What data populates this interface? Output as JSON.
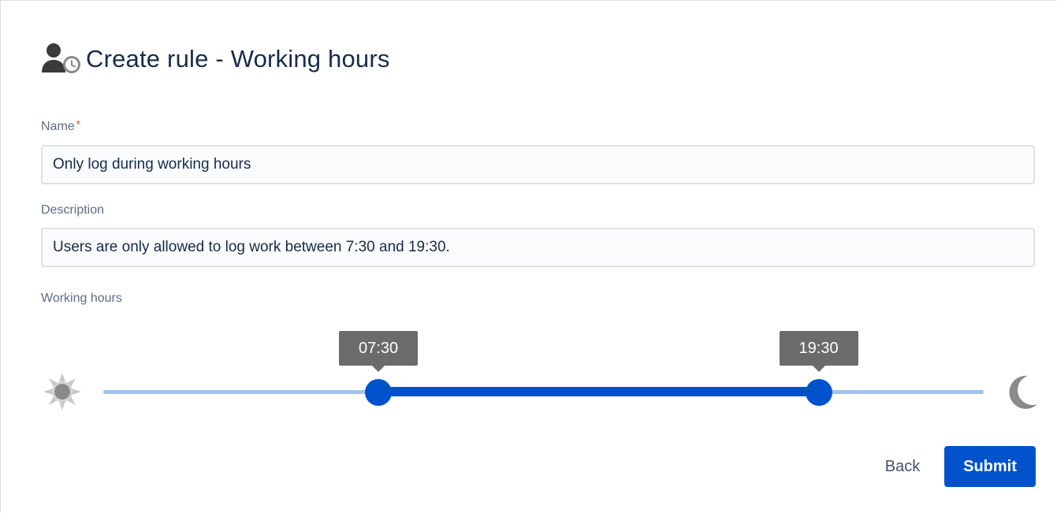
{
  "dialog": {
    "title": "Create rule - Working hours",
    "icon": "user-clock-icon"
  },
  "form": {
    "name": {
      "label": "Name",
      "required_mark": "*",
      "value": "Only log during working hours"
    },
    "description": {
      "label": "Description",
      "value": "Users are only allowed to log work between 7:30 and 19:30."
    },
    "working_hours": {
      "label": "Working hours",
      "start_label": "07:30",
      "end_label": "19:30",
      "start_fraction": 0.3125,
      "end_fraction": 0.8125,
      "left_icon": "sun-icon",
      "right_icon": "moon-icon"
    }
  },
  "actions": {
    "back_label": "Back",
    "submit_label": "Submit"
  },
  "colors": {
    "accent": "#0052cc",
    "track_light": "#a3c1ee",
    "tooltip": "#6b6b6b",
    "title": "#172b4d",
    "label": "#5e6c84",
    "required": "#de350b",
    "icon_gray": "#8a8a8a"
  }
}
